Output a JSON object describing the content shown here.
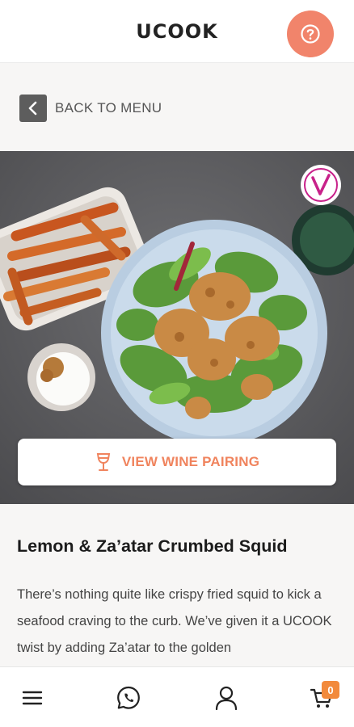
{
  "header": {
    "logo": "UCOOK",
    "help_icon": "question-circle-icon"
  },
  "back": {
    "label": "BACK TO MENU",
    "icon": "chevron-left-icon"
  },
  "hero": {
    "badge_icon": "vegetarian-v-badge-icon"
  },
  "wine": {
    "label": "VIEW WINE PAIRING",
    "icon": "wine-glass-icon"
  },
  "recipe": {
    "title": "Lemon & Za’atar Crumbed Squid",
    "description": "There’s nothing quite like crispy fried squid to kick a seafood craving to the curb. We’ve given it a UCOOK twist by adding Za’atar to the golden"
  },
  "nav": {
    "items": [
      "menu-icon",
      "whatsapp-icon",
      "user-icon",
      "cart-icon"
    ],
    "cart_count": "0"
  },
  "colors": {
    "accent": "#f1846b",
    "wine_text": "#f0845e",
    "badge": "#f28a3c"
  }
}
